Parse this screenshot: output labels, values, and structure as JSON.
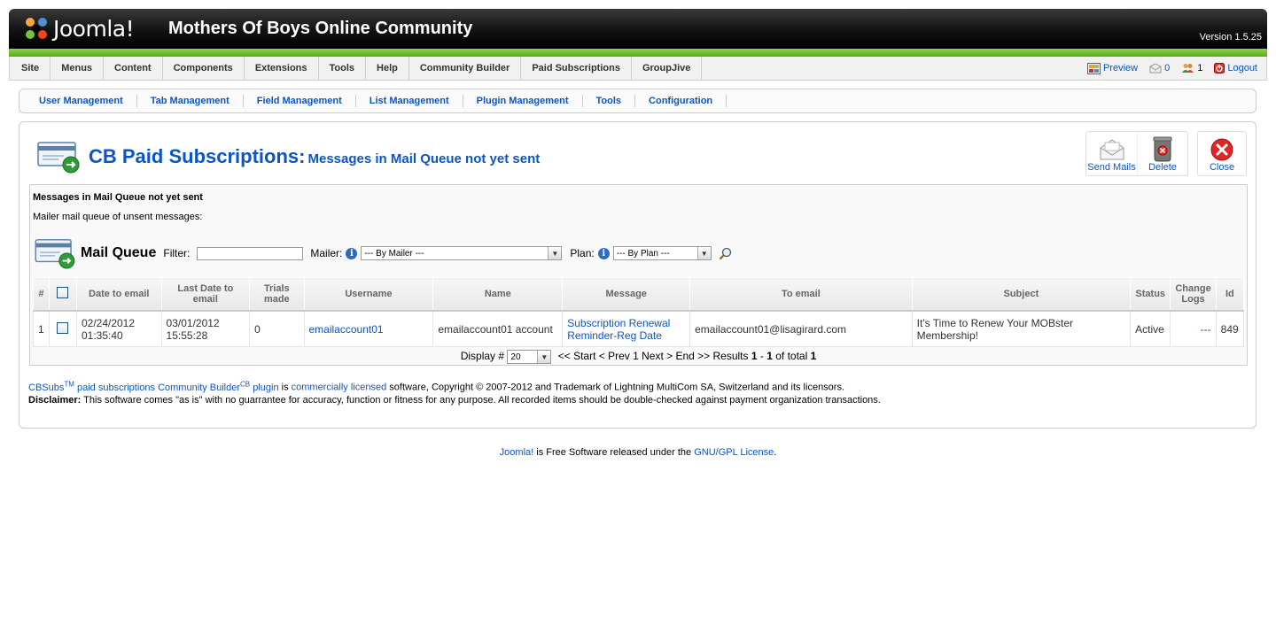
{
  "header": {
    "logo_text": "Joomla!",
    "site_name": "Mothers Of Boys Online Community",
    "version": "Version 1.5.25"
  },
  "menu": {
    "items": [
      "Site",
      "Menus",
      "Content",
      "Components",
      "Extensions",
      "Tools",
      "Help",
      "Community Builder",
      "Paid Subscriptions",
      "GroupJive"
    ],
    "status": {
      "preview": "Preview",
      "messages": "0",
      "users": "1",
      "logout": "Logout"
    }
  },
  "submenu": {
    "items": [
      "User Management",
      "Tab Management",
      "Field Management",
      "List Management",
      "Plugin Management",
      "Tools",
      "Configuration"
    ]
  },
  "page": {
    "title": "CB Paid Subscriptions:",
    "subtitle": "Messages in Mail Queue not yet sent"
  },
  "toolbar": {
    "send_mails": "Send Mails",
    "delete": "Delete",
    "close": "Close"
  },
  "panel": {
    "title": "Messages in Mail Queue not yet sent",
    "description": "Mailer mail queue of unsent messages:"
  },
  "filters": {
    "section_label": "Mail Queue",
    "filter_label": "Filter:",
    "filter_value": "",
    "mailer_label": "Mailer:",
    "mailer_value": "--- By Mailer ---",
    "plan_label": "Plan:",
    "plan_value": "--- By Plan ---"
  },
  "table": {
    "headers": {
      "num": "#",
      "date_to_email": "Date to email",
      "last_date_to_email": "Last Date to email",
      "trials_made": "Trials made",
      "username": "Username",
      "name": "Name",
      "message": "Message",
      "to_email": "To email",
      "subject": "Subject",
      "status": "Status",
      "change_logs": "Change Logs",
      "id": "Id"
    },
    "rows": [
      {
        "num": "1",
        "date_to_email_date": "02/24/2012",
        "date_to_email_time": "01:35:40",
        "last_date_date": "03/01/2012",
        "last_date_time": "15:55:28",
        "trials_made": "0",
        "username": "emailaccount01",
        "name": "emailaccount01 account",
        "message_line1": "Subscription Renewal",
        "message_line2": "Reminder-Reg Date",
        "to_email": "emailaccount01@lisagirard.com",
        "subject_line1": "It's Time to Renew Your MOBster",
        "subject_line2": "Membership!",
        "status": "Active",
        "change_logs": "---",
        "id": "849"
      }
    ]
  },
  "pagination": {
    "display_label": "Display #",
    "display_value": "20",
    "nav_text": "<< Start < Prev 1 Next > End >> Results",
    "results_from": "1",
    "results_dash": " - ",
    "results_to": "1",
    "of_total": " of total ",
    "total": "1"
  },
  "copyright": {
    "cbsubs": "CBSubs",
    "tm": "TM",
    "middle": " paid subscriptions Community Builder",
    "cb": "CB",
    "plugin": " plugin",
    "is": " is ",
    "licensed": "commercially licensed",
    "rest": " software, Copyright © 2007-2012 and Trademark of Lightning MultiCom SA, Switzerland and its licensors.",
    "disclaimer_label": "Disclaimer:",
    "disclaimer_text": " This software comes \"as is\" with no guarrantee for accuracy, function or fitness for any purpose. All recorded items should be double-checked against payment organization transactions."
  },
  "footer": {
    "joomla": "Joomla!",
    "text": " is Free Software released under the ",
    "license": "GNU/GPL License",
    "end": "."
  },
  "colors": {
    "link": "#0b55c4",
    "header_bg": "#000000",
    "green_bar": "#6fbf2a"
  }
}
